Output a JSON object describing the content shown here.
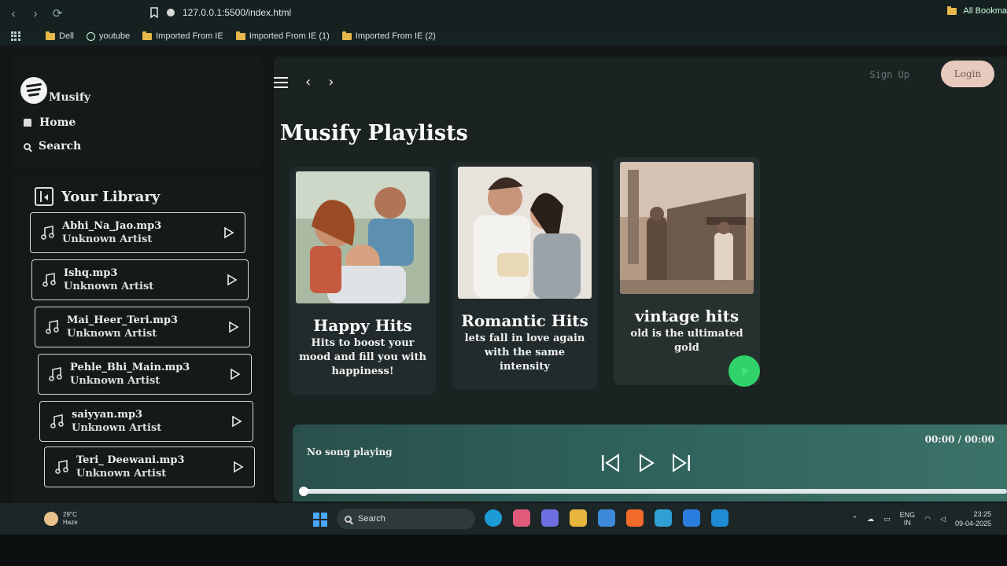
{
  "browser": {
    "url": "127.0.0.1:5500/index.html",
    "bookmarks": [
      "Dell",
      "youtube",
      "Imported From IE",
      "Imported From IE (1)",
      "Imported From IE (2)"
    ],
    "all_bookmarks": "All Bookma"
  },
  "sidebar": {
    "brand": "Musify",
    "nav": [
      {
        "label": "Home",
        "icon": "home-icon"
      },
      {
        "label": "Search",
        "icon": "search-icon"
      }
    ],
    "library_title": "Your Library",
    "songs": [
      {
        "title": "Abhi_Na_Jao.mp3",
        "artist": "Unknown Artist"
      },
      {
        "title": "Ishq.mp3",
        "artist": "Unknown Artist"
      },
      {
        "title": "Mai_Heer_Teri.mp3",
        "artist": "Unknown Artist"
      },
      {
        "title": "Pehle_Bhi_Main.mp3",
        "artist": "Unknown Artist"
      },
      {
        "title": "saiyyan.mp3",
        "artist": "Unknown Artist"
      },
      {
        "title": "Teri_ Deewani.mp3",
        "artist": "Unknown Artist"
      }
    ]
  },
  "header": {
    "signup_label": "Sign Up",
    "login_label": "Login"
  },
  "main": {
    "title": "Musify Playlists",
    "playlists": [
      {
        "title": "Happy Hits",
        "desc": "Hits to boost your mood and fill you with happiness!"
      },
      {
        "title": "Romantic Hits",
        "desc": "lets fall in love again with the same intensity"
      },
      {
        "title": "vintage hits",
        "desc": "old is the ultimated gold"
      }
    ]
  },
  "player": {
    "status": "No song playing",
    "time": "00:00 / 00:00",
    "progress": 0
  },
  "taskbar": {
    "temp": "29°C",
    "weather": "Haze",
    "search_label": "Search",
    "lang_top": "ENG",
    "lang_bottom": "IN",
    "time": "23:25",
    "date": "09-04-2025"
  },
  "colors": {
    "accent": "#2fd36a",
    "login_bg": "#e7c9be",
    "player_bg": "#2f615a"
  }
}
